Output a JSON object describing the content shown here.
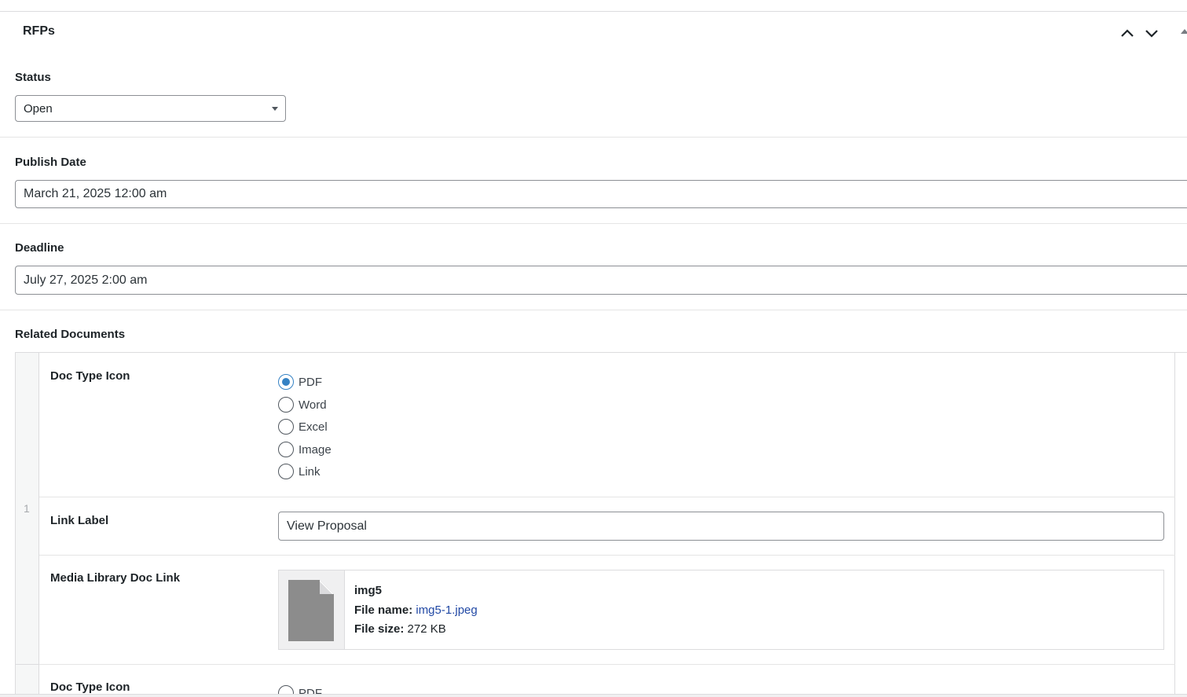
{
  "panel": {
    "title": "RFPs"
  },
  "status": {
    "label": "Status",
    "value": "Open"
  },
  "publish_date": {
    "label": "Publish Date",
    "value": "March 21, 2025 12:00 am"
  },
  "deadline": {
    "label": "Deadline",
    "value": "July 27, 2025 2:00 am"
  },
  "related_documents": {
    "label": "Related Documents",
    "rows": [
      {
        "number": "1",
        "doc_type_label": "Doc Type Icon",
        "doc_type_options": [
          "PDF",
          "Word",
          "Excel",
          "Image",
          "Link"
        ],
        "doc_type_selected": "PDF",
        "link_label_label": "Link Label",
        "link_label_value": "View Proposal",
        "media_label": "Media Library Doc Link",
        "file": {
          "title": "img5",
          "name_label": "File name:",
          "name": "img5-1.jpeg",
          "size_label": "File size:",
          "size": "272 KB"
        }
      },
      {
        "doc_type_label": "Doc Type Icon",
        "doc_type_first_option": "PDF"
      }
    ]
  },
  "icons": {
    "move_up": "chevron-up-icon",
    "move_down": "chevron-down-icon",
    "toggle": "triangle-up-icon",
    "file": "document-icon"
  },
  "colors": {
    "accent": "#3582c4",
    "link": "#2249a5"
  }
}
